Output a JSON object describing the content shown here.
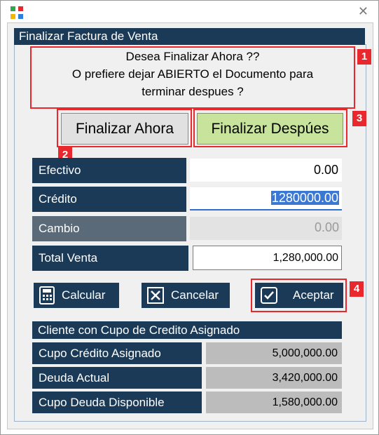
{
  "window": {
    "close_glyph": "✕"
  },
  "panel": {
    "title": "Finalizar Factura de Venta"
  },
  "message": {
    "line1": "Desea Finalizar Ahora ??",
    "line2": "O prefiere dejar ABIERTO el Documento para",
    "line3": "terminar despues ?"
  },
  "buttons": {
    "finalizar_ahora": "Finalizar Ahora",
    "finalizar_despues": "Finalizar Despúes",
    "calcular": "Calcular",
    "cancelar": "Cancelar",
    "aceptar": "Aceptar"
  },
  "payment": {
    "efectivo": {
      "label": "Efectivo",
      "value": "0.00"
    },
    "credito": {
      "label": "Crédito",
      "value": "1280000.00"
    },
    "cambio": {
      "label": "Cambio",
      "value": "0.00"
    },
    "total": {
      "label": "Total Venta",
      "value": "1,280,000.00"
    }
  },
  "credit_section": {
    "title": "Cliente con Cupo de Credito Asignado",
    "rows": [
      {
        "label": "Cupo Crédito Asignado",
        "value": "5,000,000.00"
      },
      {
        "label": "Deuda Actual",
        "value": "3,420,000.00"
      },
      {
        "label": "Cupo Deuda Disponible",
        "value": "1,580,000.00"
      }
    ]
  },
  "annotations": {
    "badge1": "1",
    "badge2": "2",
    "badge3": "3",
    "badge4": "4"
  },
  "colors": {
    "accent": "#1b3a57",
    "highlight": "#e8282c",
    "despues_bg": "#c8e39b",
    "selection": "#3a78d4"
  },
  "icons": {
    "app": "app-grid-icon",
    "calcular": "calculator-icon",
    "cancelar": "cancel-x-icon",
    "aceptar": "checkmark-icon"
  }
}
